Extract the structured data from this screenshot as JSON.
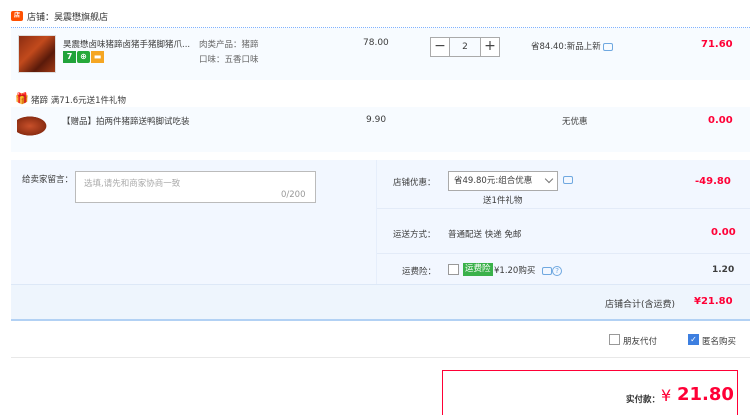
{
  "shop": {
    "label": "店铺：昊震懋旗舰店",
    "icon": "shop-icon"
  },
  "product": {
    "title": "昊震懋卤味猪蹄卤猪手猪脚猪爪...",
    "badges": [
      "7",
      "⊕",
      "▬"
    ],
    "attr_line1": "肉类产品：猪蹄",
    "attr_line2": "口味：五香口味",
    "price": "78.00",
    "quantity": "2",
    "minus": "−",
    "plus": "+",
    "save_text": "省84.40:新品上新",
    "subtotal": "71.60"
  },
  "gift": {
    "header": "猪蹄   满71.6元送1件礼物",
    "title": "【赠品】拍两件猪蹄送鸭脚试吃装",
    "price": "9.90",
    "discount": "无优惠",
    "subtotal": "0.00"
  },
  "message": {
    "label": "给卖家留言：",
    "placeholder": "选填,请先和商家协商一致",
    "count": "0/200"
  },
  "discount": {
    "label": "店铺优惠：",
    "selected": "省49.80元:组合优惠",
    "gift_note": "送1件礼物",
    "value": "-49.80"
  },
  "shipping": {
    "label": "运送方式：",
    "value": "普通配送 快递 免邮",
    "cost": "0.00"
  },
  "insurance": {
    "label": "运费险：",
    "tag": "运费险",
    "price": "¥1.20购买",
    "help": "?",
    "value": "1.20"
  },
  "total": {
    "label": "店铺合计(含运费)",
    "value": "¥21.80"
  },
  "options": {
    "friend_pay": "朋友代付",
    "anonymous": "匿名购买",
    "anonymous_check": "✓"
  },
  "payment": {
    "label": "实付款：",
    "currency": "¥",
    "value": "21.80"
  },
  "colors": {
    "accent_red": "#ff0036",
    "row_bg": "#f7fbff",
    "section_bg": "#f2f7ff",
    "checkbox_blue": "#3d7fe0"
  }
}
